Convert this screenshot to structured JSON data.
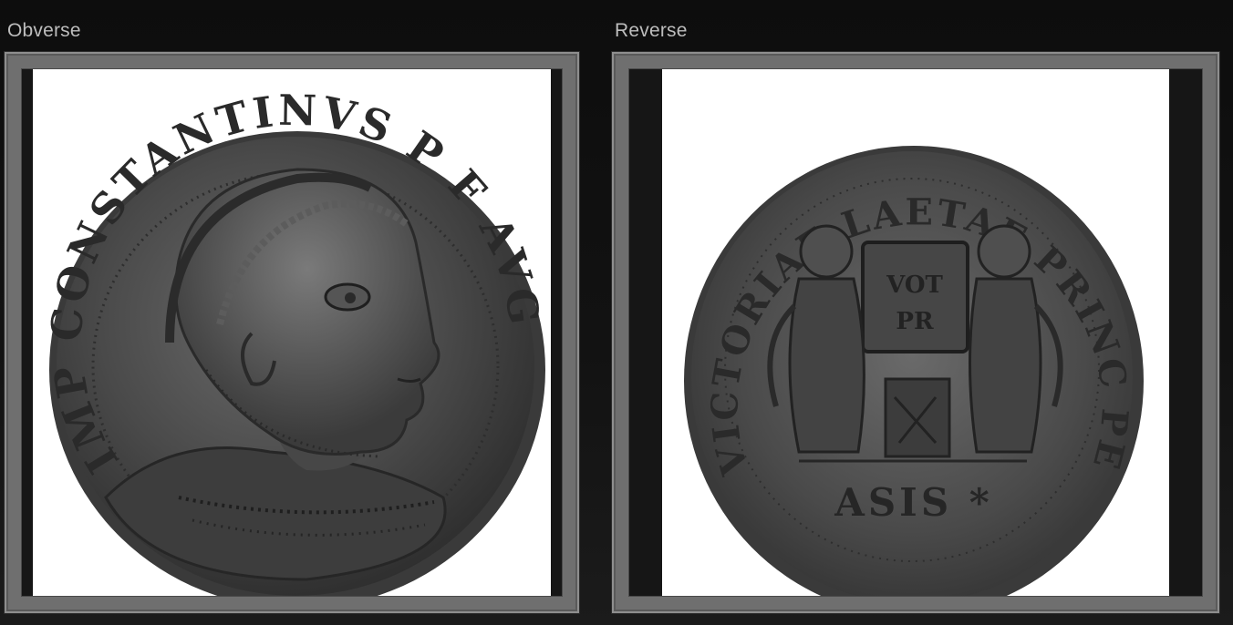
{
  "obverse": {
    "title": "Obverse",
    "legend_glyphs": "IMP CONSTANTINVS P F AVG"
  },
  "reverse": {
    "title": "Reverse",
    "legend_glyphs": "VICTORIAE LAETAE PRINC PERP",
    "shield_glyphs": [
      "VOT",
      "PR"
    ],
    "exergue_glyphs": "ASIS *"
  },
  "colors": {
    "page_background": "#121212",
    "frame": "#6f6f6f",
    "photo_background": "#ffffff",
    "coin_metal": "#4a4a4a",
    "title_text": "#bdbdbd"
  },
  "icons": {
    "obverse_image": "coin-bust-icon",
    "reverse_image": "coin-victories-icon"
  }
}
